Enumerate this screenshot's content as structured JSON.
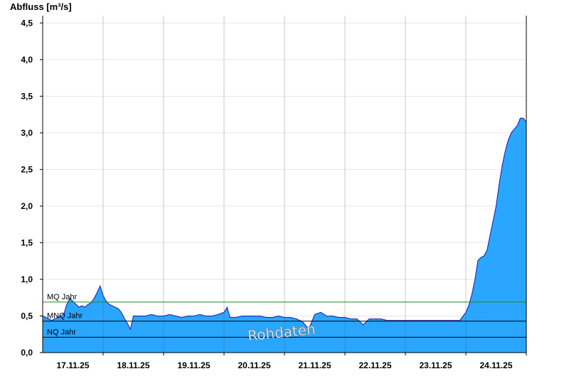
{
  "chart_data": {
    "type": "area",
    "ylabel": "Abfluss [m³/s]",
    "ylim": [
      0,
      4.6
    ],
    "yticks": [
      "0,0",
      "0,5",
      "1,0",
      "1,5",
      "2,0",
      "2,5",
      "3,0",
      "3,5",
      "4,0",
      "4,5"
    ],
    "ytick_values": [
      0,
      0.5,
      1.0,
      1.5,
      2.0,
      2.5,
      3.0,
      3.5,
      4.0,
      4.5
    ],
    "xlim": [
      0,
      8
    ],
    "x_unit": "days from 17.11.25 00:00",
    "xticks": [
      "17.11.25",
      "18.11.25",
      "19.11.25",
      "20.11.25",
      "21.11.25",
      "22.11.25",
      "23.11.25",
      "24.11.25"
    ],
    "grid": true,
    "reference_lines": [
      {
        "label": "MQ Jahr",
        "value": 0.69,
        "color": "#228b22"
      },
      {
        "label": "MNQ Jahr",
        "value": 0.43,
        "color": "#000000"
      },
      {
        "label": "NQ Jahr",
        "value": 0.21,
        "color": "#000000"
      }
    ],
    "watermark": "Rohdaten",
    "series": [
      {
        "fill": "#2aa6ff",
        "stroke": "#1a1aa8",
        "x": [
          0.0,
          0.05,
          0.1,
          0.15,
          0.2,
          0.25,
          0.3,
          0.35,
          0.4,
          0.45,
          0.5,
          0.55,
          0.6,
          0.65,
          0.7,
          0.75,
          0.8,
          0.85,
          0.9,
          0.95,
          1.0,
          1.05,
          1.1,
          1.15,
          1.2,
          1.25,
          1.3,
          1.35,
          1.4,
          1.45,
          1.5,
          1.6,
          1.7,
          1.8,
          1.9,
          2.0,
          2.1,
          2.2,
          2.3,
          2.4,
          2.5,
          2.6,
          2.7,
          2.8,
          2.9,
          3.0,
          3.05,
          3.1,
          3.2,
          3.3,
          3.4,
          3.5,
          3.6,
          3.7,
          3.8,
          3.9,
          4.0,
          4.1,
          4.2,
          4.3,
          4.4,
          4.5,
          4.6,
          4.7,
          4.8,
          4.9,
          5.0,
          5.1,
          5.2,
          5.3,
          5.4,
          5.5,
          5.6,
          5.7,
          5.8,
          5.9,
          6.0,
          6.1,
          6.2,
          6.3,
          6.4,
          6.5,
          6.6,
          6.7,
          6.8,
          6.9,
          7.0,
          7.05,
          7.1,
          7.15,
          7.2,
          7.25,
          7.3,
          7.35,
          7.4,
          7.45,
          7.5,
          7.55,
          7.6,
          7.65,
          7.7,
          7.75,
          7.8,
          7.85,
          7.9,
          7.95,
          8.0
        ],
        "y": [
          0.5,
          0.48,
          0.46,
          0.44,
          0.46,
          0.48,
          0.5,
          0.53,
          0.66,
          0.74,
          0.7,
          0.66,
          0.62,
          0.64,
          0.62,
          0.66,
          0.68,
          0.74,
          0.82,
          0.91,
          0.78,
          0.7,
          0.66,
          0.64,
          0.62,
          0.6,
          0.55,
          0.47,
          0.4,
          0.32,
          0.5,
          0.5,
          0.5,
          0.52,
          0.5,
          0.5,
          0.52,
          0.5,
          0.48,
          0.5,
          0.5,
          0.52,
          0.5,
          0.5,
          0.52,
          0.55,
          0.62,
          0.48,
          0.48,
          0.5,
          0.5,
          0.5,
          0.5,
          0.48,
          0.48,
          0.5,
          0.48,
          0.48,
          0.46,
          0.42,
          0.32,
          0.52,
          0.55,
          0.5,
          0.5,
          0.48,
          0.48,
          0.46,
          0.46,
          0.38,
          0.46,
          0.46,
          0.46,
          0.44,
          0.44,
          0.44,
          0.44,
          0.44,
          0.44,
          0.44,
          0.44,
          0.44,
          0.44,
          0.44,
          0.44,
          0.44,
          0.55,
          0.65,
          0.8,
          1.0,
          1.26,
          1.3,
          1.32,
          1.4,
          1.6,
          1.8,
          2.0,
          2.3,
          2.55,
          2.75,
          2.9,
          3.0,
          3.05,
          3.1,
          3.2,
          3.2,
          3.15
        ]
      }
    ]
  }
}
